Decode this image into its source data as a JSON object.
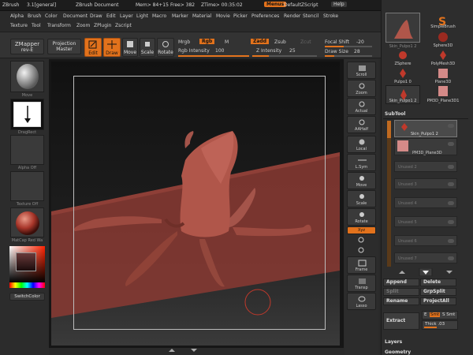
{
  "titlebar": {
    "app": "ZBrush",
    "version": "3.1[general]",
    "doc": "ZBrush Document",
    "mem": "Mem> 84+15",
    "free": "Free> 382",
    "ztime": "ZTime> 00:35:02",
    "menus": "Menus",
    "script": "DefaultZScript",
    "help": "Help"
  },
  "menu_row1": [
    "Alpha",
    "Brush",
    "Color",
    "Document",
    "Draw",
    "Edit",
    "Layer",
    "Light",
    "Macro",
    "Marker",
    "Material",
    "Movie",
    "Picker",
    "Preferences",
    "Render",
    "Stencil",
    "Stroke"
  ],
  "menu_row2": [
    "Texture",
    "Tool",
    "Transform",
    "Zoom",
    "ZPlugin",
    "Zscript"
  ],
  "toolbar": {
    "zmapper": "ZMapper",
    "zmapper_sub": "rev-E",
    "projection": "Projection",
    "projection_sub": "Master",
    "edit": "Edit",
    "draw": "Draw",
    "move": "Move",
    "scale": "Scale",
    "rotate": "Rotate",
    "mrgb": "Mrgb",
    "rgb": "Rgb",
    "m": "M",
    "rgb_intensity_label": "Rgb Intensity",
    "rgb_intensity_value": "100",
    "zadd": "Zadd",
    "zsub": "Zsub",
    "zcut": "Zcut",
    "z_intensity_label": "Z Intensity",
    "z_intensity_value": "25",
    "focal_shift_label": "Focal Shift",
    "focal_shift_value": "-20",
    "draw_size_label": "Draw Size",
    "draw_size_value": "28"
  },
  "left_shelf": {
    "brush_label": "Move",
    "stroke_label": "DragRect",
    "alpha_label": "Alpha  Off",
    "texture_label": "Texture  Off",
    "material_label": "MatCap Red Wa",
    "switch_color": "SwitchColor"
  },
  "right_shelf": [
    "Scroll",
    "Zoom",
    "Actual",
    "AAHalf",
    "Local",
    "L.Sym",
    "Move",
    "Scale",
    "Rotate",
    "Frame",
    "Transp",
    "Lasso"
  ],
  "right_shelf_extra": "Xyz",
  "tray": {
    "tools": [
      {
        "name": "Skin_Pulpo1 2"
      },
      {
        "name": "SimpleBrush"
      },
      {
        "name": "Sphere3D"
      },
      {
        "name": "ZSphere"
      },
      {
        "name": "PolyMesh3D"
      },
      {
        "name": "Pulpo1 0"
      },
      {
        "name": "Plane3D"
      },
      {
        "name": "Skin_Pulpo1 2"
      },
      {
        "name": "PM3D_Plane3D1"
      }
    ],
    "subtool_title": "SubTool",
    "subtools": [
      "Skin_Pulpo1 2",
      "PM3D_Plane3D",
      "Unused  2",
      "Unused  3",
      "Unused  4",
      "Unused  5",
      "Unused  6",
      "Unused  7"
    ],
    "buttons": {
      "append": "Append",
      "delete": "Delete",
      "split": "Split",
      "grpsplit": "GrpSplit",
      "rename": "Rename",
      "projectall": "ProjectAll",
      "extract": "Extract",
      "e_smt": "E",
      "smt": "Smt",
      "s_smt": "S  Smt",
      "thick": "Thick .03"
    },
    "layers_title": "Layers",
    "geometry_title": "Geometry"
  },
  "colors": {
    "accent": "#e2721c",
    "model": "#b0564a",
    "floor": "#8a3a33"
  }
}
